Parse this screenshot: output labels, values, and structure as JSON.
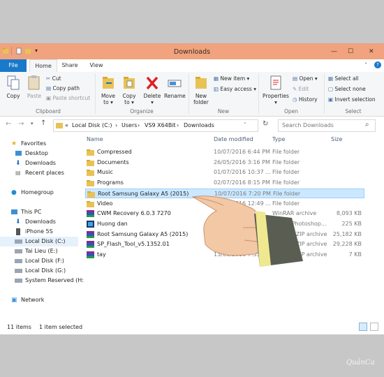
{
  "window": {
    "title": "Downloads"
  },
  "ribbon_tabs": [
    "File",
    "Home",
    "Share",
    "View"
  ],
  "clipboard": {
    "copy": "Copy",
    "paste": "Paste",
    "cut": "Cut",
    "copy_path": "Copy path",
    "paste_shortcut": "Paste shortcut",
    "group": "Clipboard"
  },
  "organize": {
    "move_to": "Move",
    "move_to2": "to ▾",
    "copy_to": "Copy",
    "copy_to2": "to ▾",
    "delete": "Delete",
    "delete2": "▾",
    "rename": "Rename",
    "group": "Organize"
  },
  "new": {
    "new_folder": "New",
    "new_folder2": "folder",
    "new_item": "New item ▾",
    "easy_access": "Easy access ▾",
    "group": "New"
  },
  "open": {
    "properties": "Properties",
    "properties2": "▾",
    "open": "Open ▾",
    "edit": "Edit",
    "history": "History",
    "group": "Open"
  },
  "select": {
    "select_all": "Select all",
    "select_none": "Select none",
    "invert": "Invert selection",
    "group": "Select"
  },
  "address": {
    "crumbs": [
      "«",
      "Local Disk (C:)",
      "›",
      "Users",
      "›",
      "VS9 X64Bit",
      "›",
      "Downloads"
    ],
    "search_placeholder": "Search Downloads"
  },
  "nav": {
    "items": [
      {
        "label": "Favorites",
        "icon": "star-icon",
        "indent": 0
      },
      {
        "label": "Desktop",
        "icon": "desktop-icon",
        "indent": 1
      },
      {
        "label": "Downloads",
        "icon": "downloads-icon",
        "indent": 1
      },
      {
        "label": "Recent places",
        "icon": "recent-icon",
        "indent": 1
      },
      {
        "label": "Homegroup",
        "icon": "homegroup-icon",
        "indent": 0
      },
      {
        "label": "This PC",
        "icon": "pc-icon",
        "indent": 0
      },
      {
        "label": "Downloads",
        "icon": "downloads-icon",
        "indent": 1
      },
      {
        "label": "iPhone 5S",
        "icon": "phone-icon",
        "indent": 1
      },
      {
        "label": "Local Disk (C:)",
        "icon": "drive-icon",
        "indent": 1,
        "selected": true
      },
      {
        "label": "Tai Lieu (E:)",
        "icon": "drive-icon",
        "indent": 1
      },
      {
        "label": "Local Disk (F:)",
        "icon": "drive-icon",
        "indent": 1
      },
      {
        "label": "Local Disk (G:)",
        "icon": "drive-icon",
        "indent": 1
      },
      {
        "label": "System Reserved (H:",
        "icon": "drive-icon",
        "indent": 1
      },
      {
        "label": "Network",
        "icon": "network-icon",
        "indent": 0
      }
    ]
  },
  "columns": {
    "name": "Name",
    "date": "Date modified",
    "type": "Type",
    "size": "Size"
  },
  "files": [
    {
      "name": "Compressed",
      "date": "10/07/2016 6:44 PM",
      "type": "File folder",
      "size": "",
      "icon": "folder-icon"
    },
    {
      "name": "Documents",
      "date": "26/05/2016 3:16 PM",
      "type": "File folder",
      "size": "",
      "icon": "folder-icon"
    },
    {
      "name": "Music",
      "date": "01/07/2016 10:37 ...",
      "type": "File folder",
      "size": "",
      "icon": "folder-icon"
    },
    {
      "name": "Programs",
      "date": "02/07/2016 8:15 PM",
      "type": "File folder",
      "size": "",
      "icon": "folder-icon"
    },
    {
      "name": "Root Samsung Galaxy A5 (2015)",
      "date": "10/07/2016 7:20 PM",
      "type": "File folder",
      "size": "",
      "icon": "folder-icon",
      "selected": true
    },
    {
      "name": "Video",
      "date": "10/07/2016 12:49 ...",
      "type": "File folder",
      "size": "",
      "icon": "folder-icon"
    },
    {
      "name": "CWM Recovery 6.0.3 7270",
      "date": "",
      "type": "WinRAR archive",
      "size": "8,093 KB",
      "icon": "archive-icon"
    },
    {
      "name": "Huong dan",
      "date": "",
      "type": "Adobe Photoshop...",
      "size": "225 KB",
      "icon": "image-icon"
    },
    {
      "name": "Root Samsung Galaxy A5 (2015)",
      "date": "",
      "type": "WinRAR ZIP archive",
      "size": "25,182 KB",
      "icon": "archive-icon"
    },
    {
      "name": "SP_Flash_Tool_v5.1352.01",
      "date": "13/06/2016 6:14 PM",
      "type": "WinRAR ZIP archive",
      "size": "29,228 KB",
      "icon": "archive-icon"
    },
    {
      "name": "tay",
      "date": "13/05/2016 7:55 PM",
      "type": "WinRAR ZIP archive",
      "size": "7 KB",
      "icon": "archive-icon"
    }
  ],
  "status": {
    "count": "11 items",
    "selected": "1 item selected"
  },
  "watermark": "QuảnCa"
}
